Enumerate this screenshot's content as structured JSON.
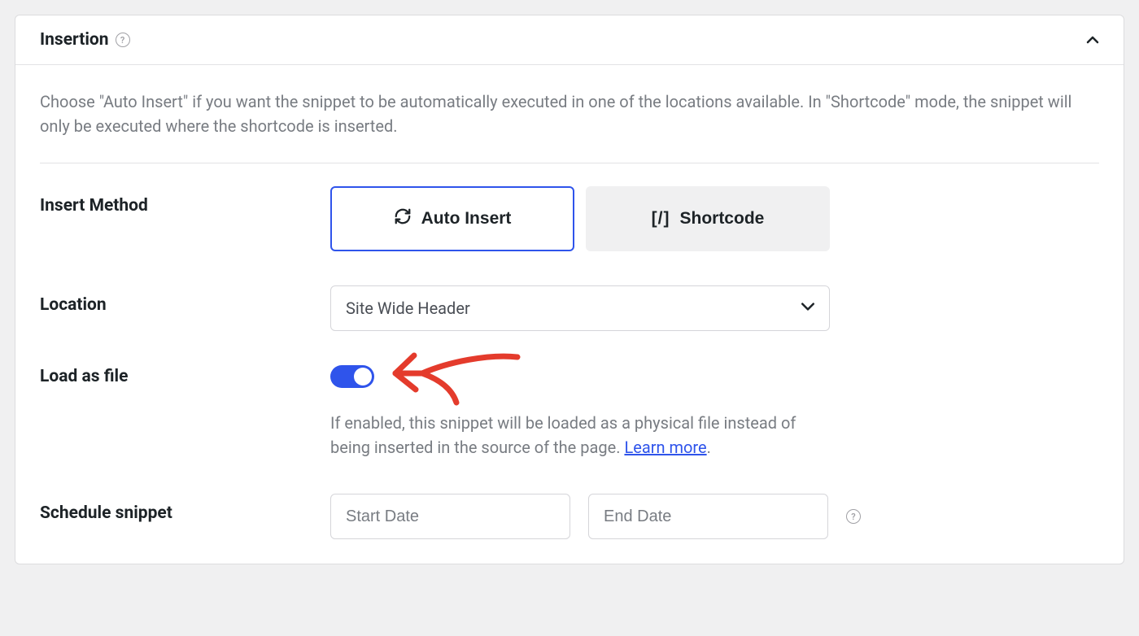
{
  "panel": {
    "title": "Insertion",
    "description": "Choose \"Auto Insert\" if you want the snippet to be automatically executed in one of the locations available. In \"Shortcode\" mode, the snippet will only be executed where the shortcode is inserted."
  },
  "insertMethod": {
    "label": "Insert Method",
    "options": {
      "autoInsert": "Auto Insert",
      "shortcode": "Shortcode"
    }
  },
  "location": {
    "label": "Location",
    "selected": "Site Wide Header"
  },
  "loadAsFile": {
    "label": "Load as file",
    "enabled": true,
    "helpText": "If enabled, this snippet will be loaded as a physical file instead of being inserted in the source of the page. ",
    "learnMore": "Learn more"
  },
  "schedule": {
    "label": "Schedule snippet",
    "startPlaceholder": "Start Date",
    "endPlaceholder": "End Date"
  }
}
